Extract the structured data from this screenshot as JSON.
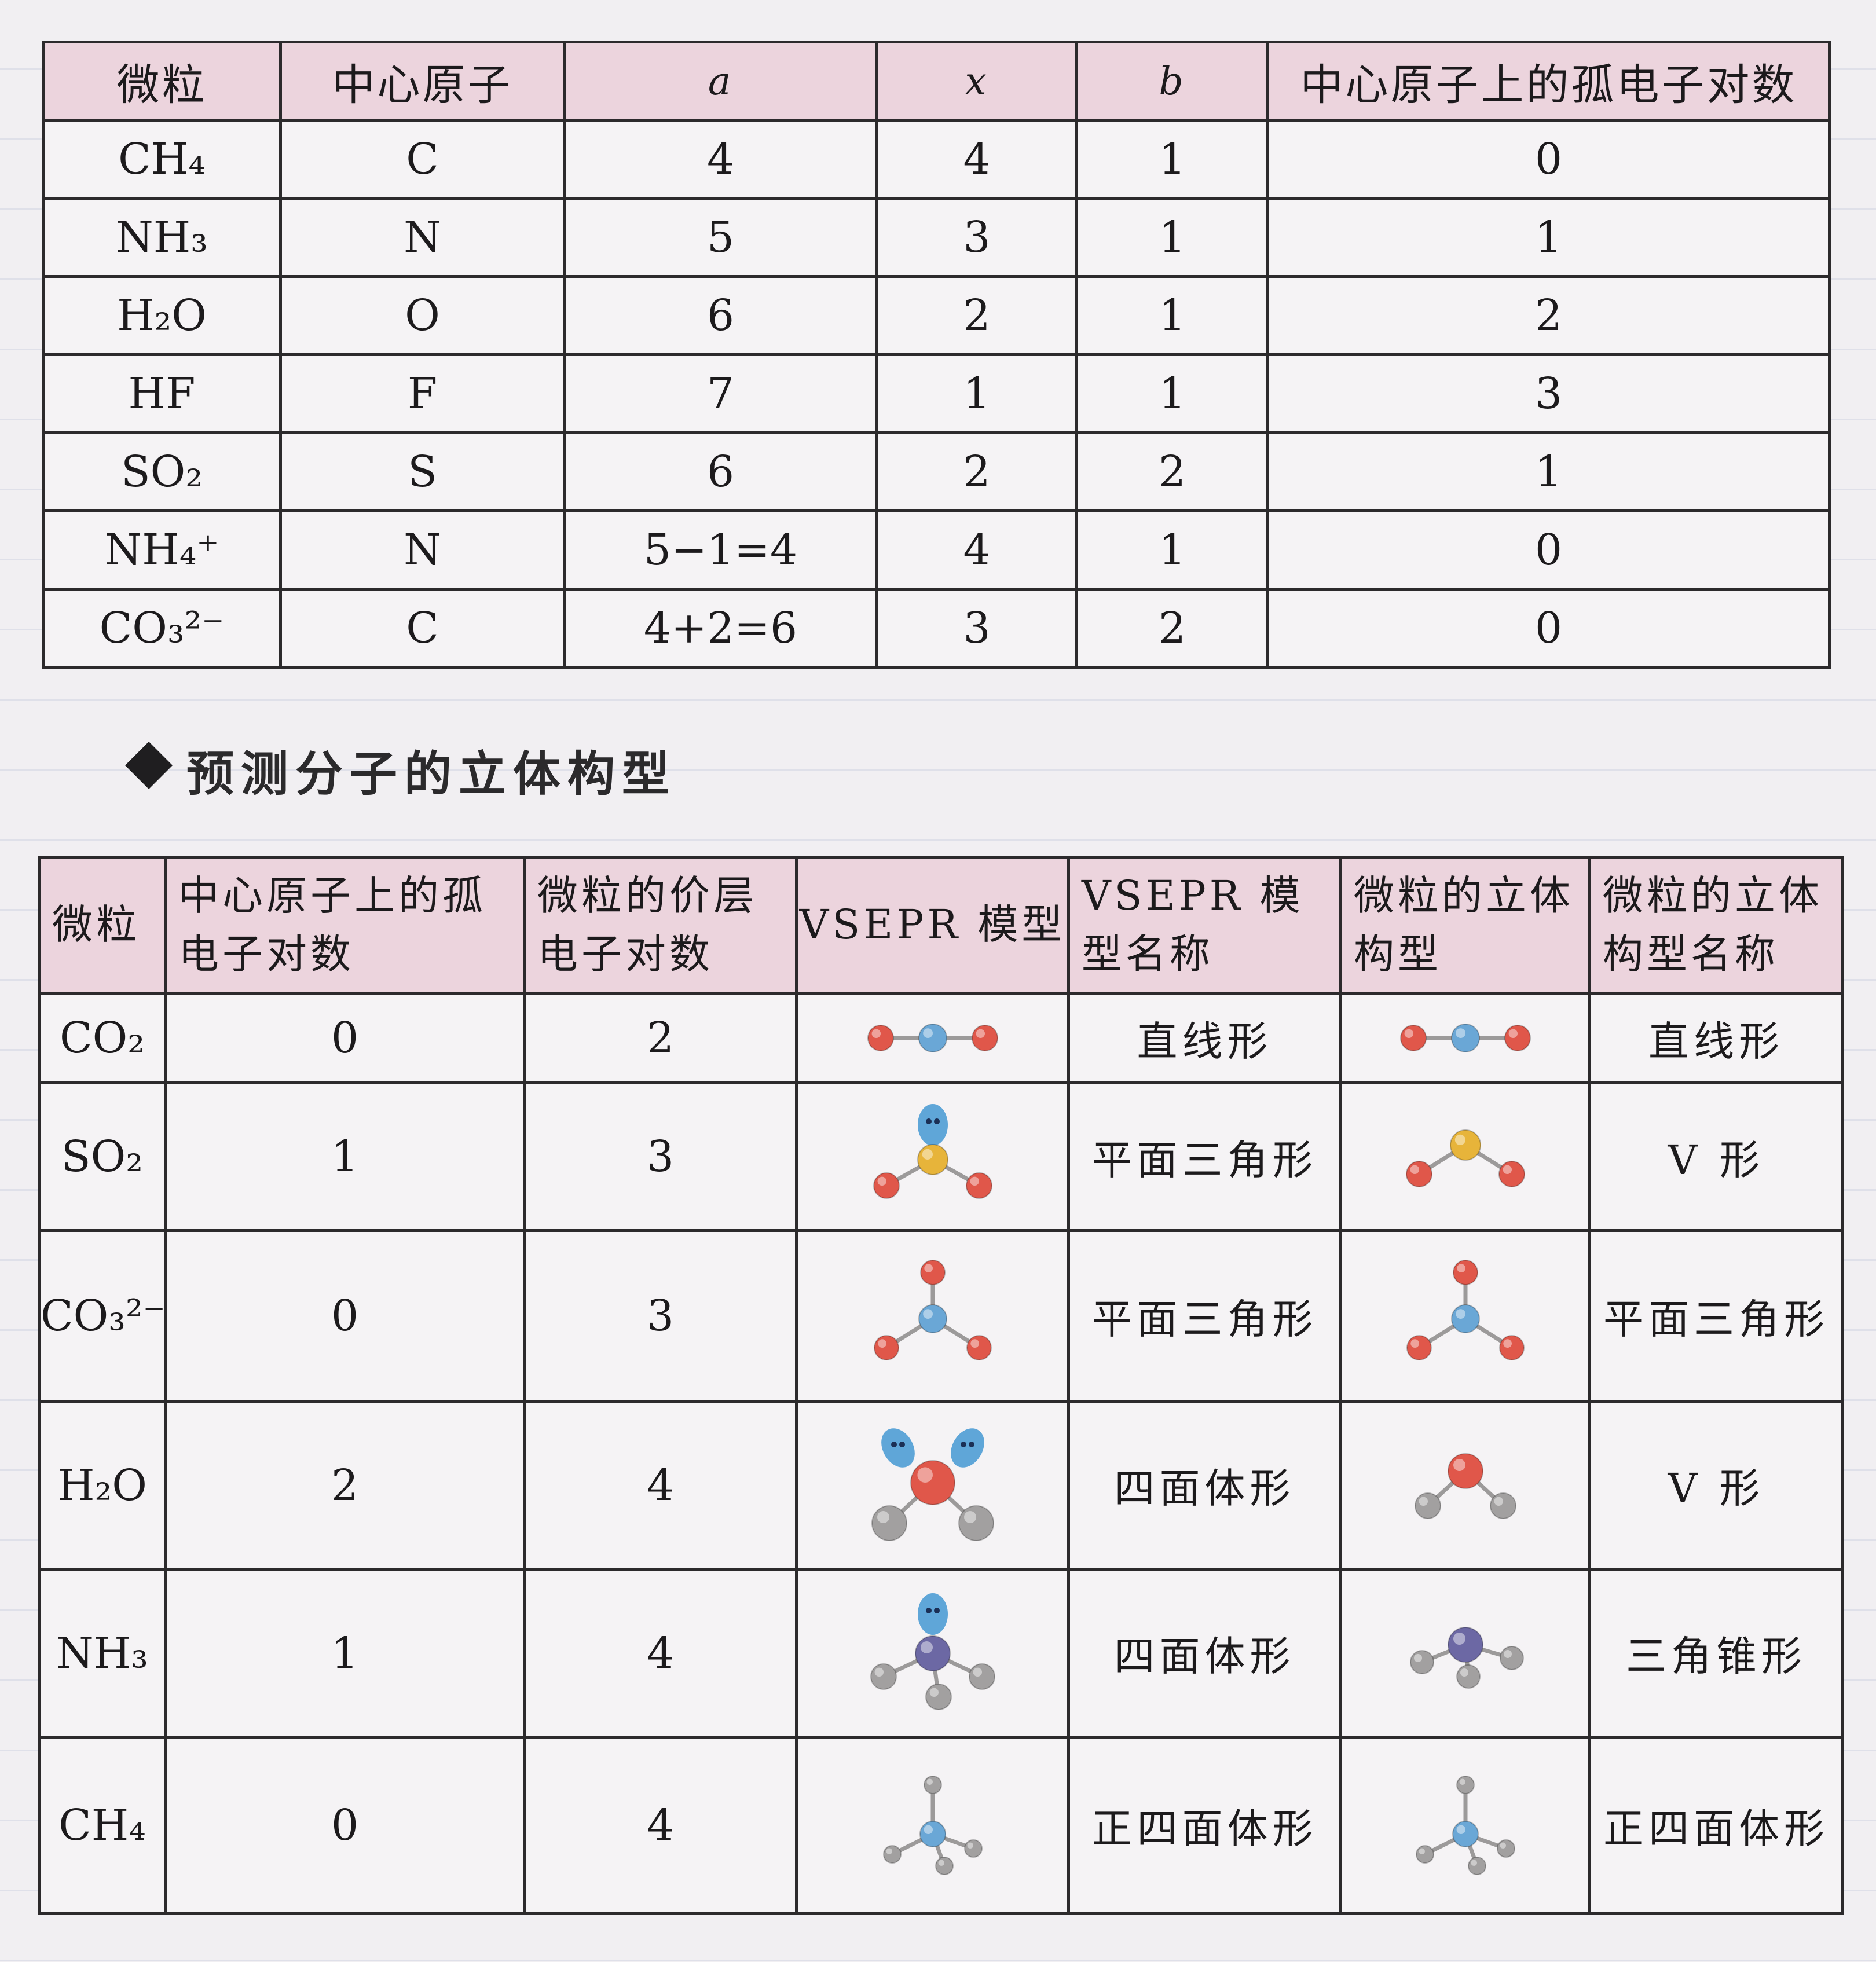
{
  "table1": {
    "headers": [
      "微粒",
      "中心原子",
      "a",
      "x",
      "b",
      "中心原子上的孤电子对数"
    ],
    "rows": [
      {
        "particle": "CH₄",
        "center": "C",
        "a": "4",
        "x": "4",
        "b": "1",
        "lone": "0"
      },
      {
        "particle": "NH₃",
        "center": "N",
        "a": "5",
        "x": "3",
        "b": "1",
        "lone": "1"
      },
      {
        "particle": "H₂O",
        "center": "O",
        "a": "6",
        "x": "2",
        "b": "1",
        "lone": "2"
      },
      {
        "particle": "HF",
        "center": "F",
        "a": "7",
        "x": "1",
        "b": "1",
        "lone": "3"
      },
      {
        "particle": "SO₂",
        "center": "S",
        "a": "6",
        "x": "2",
        "b": "2",
        "lone": "1"
      },
      {
        "particle": "NH₄⁺",
        "center": "N",
        "a": "5−1=4",
        "x": "4",
        "b": "1",
        "lone": "0"
      },
      {
        "particle": "CO₃²⁻",
        "center": "C",
        "a": "4+2=6",
        "x": "3",
        "b": "2",
        "lone": "0"
      }
    ]
  },
  "section": {
    "title": "预测分子的立体构型"
  },
  "table2": {
    "headers": [
      "微粒",
      "中心原子上的孤电子对数",
      "微粒的价层电子对数",
      "VSEPR 模型",
      "VSEPR 模型名称",
      "微粒的立体构型",
      "微粒的立体构型名称"
    ],
    "rows": [
      {
        "particle": "CO₂",
        "lone": "0",
        "valence": "2",
        "vsepr_name": "直线形",
        "shape_name": "直线形",
        "vsepr_model": "linear-model-icon",
        "shape_model": "linear-shape-icon"
      },
      {
        "particle": "SO₂",
        "lone": "1",
        "valence": "3",
        "vsepr_name": "平面三角形",
        "shape_name": "V 形",
        "vsepr_model": "trigonal-planar-lone-pair-icon",
        "shape_model": "bent-shape-icon"
      },
      {
        "particle": "CO₃²⁻",
        "lone": "0",
        "valence": "3",
        "vsepr_name": "平面三角形",
        "shape_name": "平面三角形",
        "vsepr_model": "trigonal-planar-model-icon",
        "shape_model": "trigonal-planar-shape-icon"
      },
      {
        "particle": "H₂O",
        "lone": "2",
        "valence": "4",
        "vsepr_name": "四面体形",
        "shape_name": "V 形",
        "vsepr_model": "tetrahedral-two-lone-pairs-icon",
        "shape_model": "bent-water-icon"
      },
      {
        "particle": "NH₃",
        "lone": "1",
        "valence": "4",
        "vsepr_name": "四面体形",
        "shape_name": "三角锥形",
        "vsepr_model": "tetrahedral-one-lone-pair-icon",
        "shape_model": "trigonal-pyramidal-icon"
      },
      {
        "particle": "CH₄",
        "lone": "0",
        "valence": "4",
        "vsepr_name": "正四面体形",
        "shape_name": "正四面体形",
        "vsepr_model": "tetrahedral-model-icon",
        "shape_model": "tetrahedral-shape-icon"
      }
    ]
  },
  "colors": {
    "header_bg": "#ecd4dd",
    "oxygen": "#e0574a",
    "carbon": "#6aa7d6",
    "sulfur": "#e7b43a",
    "nitrogen": "#6c68a4",
    "hydrogen": "#a2a0a0",
    "lone_pair": "#5fa6d8"
  }
}
